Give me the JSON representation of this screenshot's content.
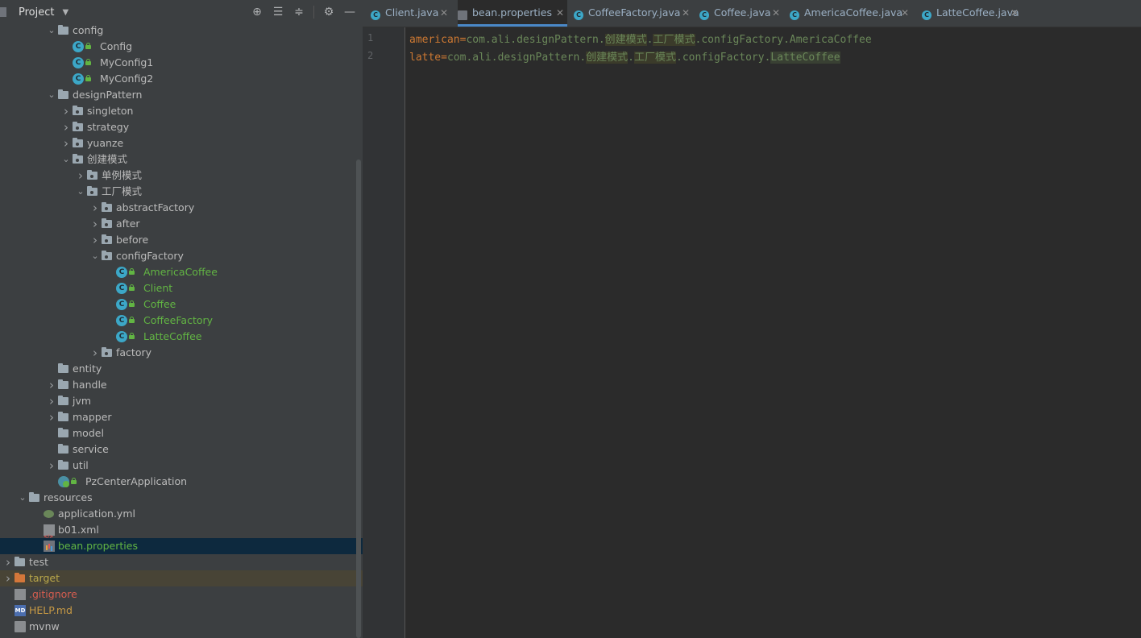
{
  "project": {
    "title": "Project",
    "tools": [
      "locate-icon",
      "expand-all-icon",
      "collapse-all-icon",
      "settings-icon",
      "hide-icon"
    ],
    "tree": [
      {
        "label": "config",
        "type": "folder",
        "expanded": true,
        "color": "default"
      },
      {
        "label": "Config",
        "type": "class",
        "color": "default"
      },
      {
        "label": "MyConfig1",
        "type": "class",
        "color": "default"
      },
      {
        "label": "MyConfig2",
        "type": "class",
        "color": "default"
      },
      {
        "label": "designPattern",
        "type": "folder",
        "expanded": true,
        "color": "default"
      },
      {
        "label": "singleton",
        "type": "package",
        "expanded": false,
        "color": "default"
      },
      {
        "label": "strategy",
        "type": "package",
        "expanded": false,
        "color": "default"
      },
      {
        "label": "yuanze",
        "type": "package",
        "expanded": false,
        "color": "default"
      },
      {
        "label": "创建模式",
        "type": "package",
        "expanded": true,
        "color": "default"
      },
      {
        "label": "单例模式",
        "type": "package",
        "expanded": false,
        "color": "default"
      },
      {
        "label": "工厂模式",
        "type": "package",
        "expanded": true,
        "color": "default"
      },
      {
        "label": "abstractFactory",
        "type": "package",
        "expanded": false,
        "color": "default"
      },
      {
        "label": "after",
        "type": "package",
        "expanded": false,
        "color": "default"
      },
      {
        "label": "before",
        "type": "package",
        "expanded": false,
        "color": "default"
      },
      {
        "label": "configFactory",
        "type": "package",
        "expanded": true,
        "color": "default"
      },
      {
        "label": "AmericaCoffee",
        "type": "class",
        "color": "green"
      },
      {
        "label": "Client",
        "type": "class",
        "color": "green"
      },
      {
        "label": "Coffee",
        "type": "class",
        "color": "green"
      },
      {
        "label": "CoffeeFactory",
        "type": "class",
        "color": "green"
      },
      {
        "label": "LatteCoffee",
        "type": "class",
        "color": "green"
      },
      {
        "label": "factory",
        "type": "package",
        "expanded": false,
        "color": "default"
      },
      {
        "label": "entity",
        "type": "folder",
        "color": "default"
      },
      {
        "label": "handle",
        "type": "folder",
        "expanded": false,
        "color": "default"
      },
      {
        "label": "jvm",
        "type": "folder",
        "expanded": false,
        "color": "default"
      },
      {
        "label": "mapper",
        "type": "folder",
        "expanded": false,
        "color": "default"
      },
      {
        "label": "model",
        "type": "folder",
        "color": "default"
      },
      {
        "label": "service",
        "type": "folder",
        "color": "default"
      },
      {
        "label": "util",
        "type": "folder",
        "expanded": false,
        "color": "default"
      },
      {
        "label": "PzCenterApplication",
        "type": "app",
        "color": "default"
      },
      {
        "label": "resources",
        "type": "folder",
        "expanded": true,
        "color": "default"
      },
      {
        "label": "application.yml",
        "type": "yml",
        "color": "default"
      },
      {
        "label": "b01.xml",
        "type": "xml",
        "color": "default"
      },
      {
        "label": "bean.properties",
        "type": "props",
        "color": "green",
        "selected": true
      },
      {
        "label": "test",
        "type": "folder",
        "expanded": false,
        "color": "default"
      },
      {
        "label": "target",
        "type": "folder-orange",
        "expanded": false,
        "color": "olive",
        "excluded": true
      },
      {
        "label": ".gitignore",
        "type": "git",
        "color": "red"
      },
      {
        "label": "HELP.md",
        "type": "md",
        "color": "orange"
      },
      {
        "label": "mvnw",
        "type": "file",
        "color": "default"
      }
    ]
  },
  "editor": {
    "tabs": [
      {
        "name": "Client.java",
        "icon": "class-icon",
        "active": false
      },
      {
        "name": "bean.properties",
        "icon": "properties-icon",
        "active": true
      },
      {
        "name": "CoffeeFactory.java",
        "icon": "class-icon",
        "active": false
      },
      {
        "name": "Coffee.java",
        "icon": "class-icon",
        "active": false
      },
      {
        "name": "AmericaCoffee.java",
        "icon": "class-icon",
        "active": false
      },
      {
        "name": "LatteCoffee.java",
        "icon": "class-icon",
        "active": false
      }
    ],
    "lines": [
      {
        "num": "1",
        "key": "american",
        "eq": "=",
        "pre": "com.ali.designPattern.",
        "h1": "创建模式",
        "dot": ".",
        "h2": "工厂模式",
        "post": ".configFactory.AmericaCoffee"
      },
      {
        "num": "2",
        "key": "latte",
        "eq": "=",
        "pre": "com.ali.designPattern.",
        "h1": "创建模式",
        "dot": ".",
        "h2": "工厂模式",
        "post": ".configFactory.",
        "last": "LatteCoffee"
      }
    ]
  }
}
